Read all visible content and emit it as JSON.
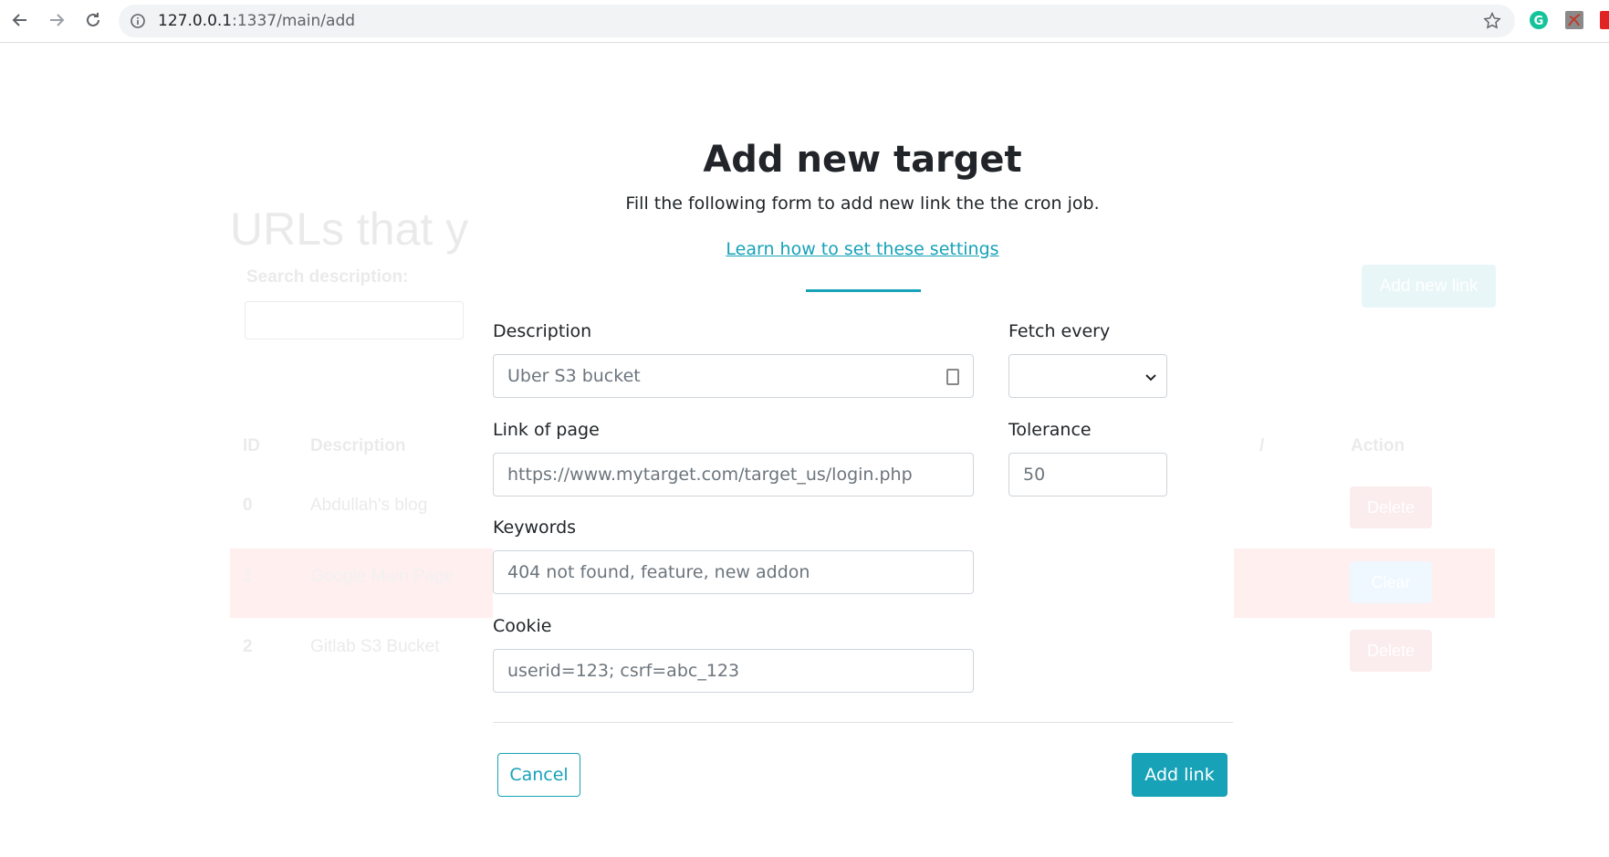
{
  "browser": {
    "url_host": "127.0.0.1",
    "url_path": ":1337/main/add"
  },
  "background": {
    "title": "URLs that y",
    "search_label": "Search description:",
    "add_button": "Add new link",
    "columns": [
      "ID",
      "Description",
      "/",
      "Action"
    ],
    "rows": [
      {
        "id": "0",
        "description": "Abdullah's blog",
        "action": "Delete",
        "highlight": false
      },
      {
        "id": "1",
        "description": "Google Main Page",
        "action": "Clear",
        "highlight": true
      },
      {
        "id": "2",
        "description": "Gitlab S3 Bucket",
        "action": "Delete",
        "highlight": false
      }
    ]
  },
  "form": {
    "title": "Add new target",
    "subtitle": "Fill the following form to add new link the the cron job.",
    "learn_link": "Learn how to set these settings",
    "description": {
      "label": "Description",
      "placeholder": "Uber S3 bucket"
    },
    "link": {
      "label": "Link of page",
      "placeholder": "https://www.mytarget.com/target_us/login.php"
    },
    "keywords": {
      "label": "Keywords",
      "placeholder": "404 not found, feature, new addon"
    },
    "cookie": {
      "label": "Cookie",
      "placeholder": "userid=123; csrf=abc_123"
    },
    "fetch_every": {
      "label": "Fetch every",
      "value": ""
    },
    "tolerance": {
      "label": "Tolerance",
      "placeholder": "50"
    },
    "cancel_label": "Cancel",
    "submit_label": "Add link"
  },
  "colors": {
    "accent": "#17a2b8"
  }
}
